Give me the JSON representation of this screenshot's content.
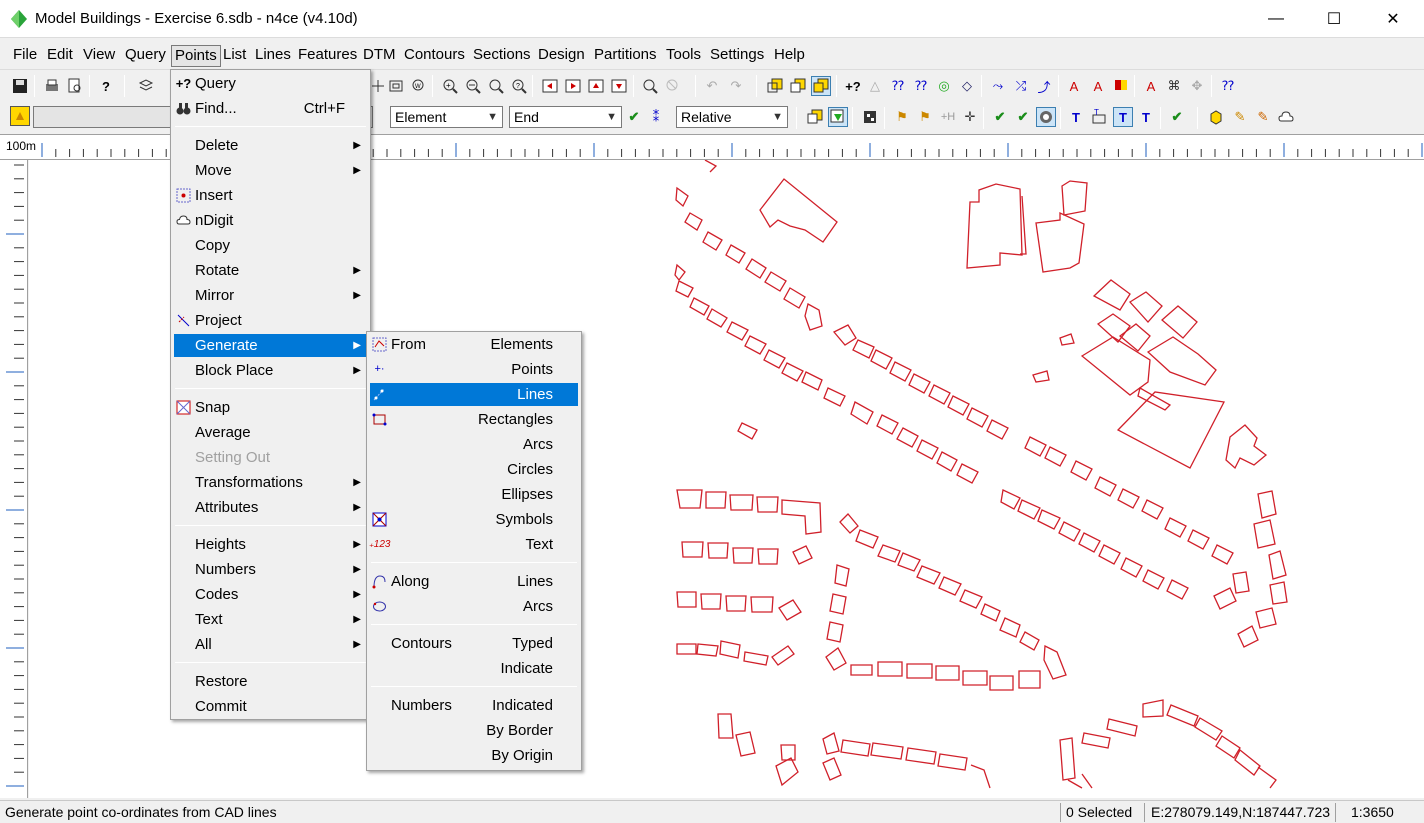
{
  "window": {
    "title": "Model Buildings - Exercise 6.sdb - n4ce (v4.10d)",
    "minimize": "—",
    "maximize": "☐",
    "close": "✕"
  },
  "menubar": [
    "File",
    "Edit",
    "View",
    "Query",
    "Points",
    "List",
    "Lines",
    "Features",
    "DTM",
    "Contours",
    "Sections",
    "Design",
    "Partitions",
    "Tools",
    "Settings",
    "Help"
  ],
  "toolbar2": {
    "combo_element": "Element",
    "combo_end": "End",
    "combo_relative": "Relative"
  },
  "ruler": {
    "label": "100m"
  },
  "points_menu": {
    "query": "Query",
    "find": "Find...",
    "find_shortcut": "Ctrl+F",
    "delete": "Delete",
    "move": "Move",
    "insert": "Insert",
    "ndigit": "nDigit",
    "copy": "Copy",
    "rotate": "Rotate",
    "mirror": "Mirror",
    "project": "Project",
    "generate": "Generate",
    "block_place": "Block Place",
    "snap": "Snap",
    "average": "Average",
    "setting_out": "Setting Out",
    "transformations": "Transformations",
    "attributes": "Attributes",
    "heights": "Heights",
    "numbers": "Numbers",
    "codes": "Codes",
    "text": "Text",
    "all": "All",
    "restore": "Restore",
    "commit": "Commit"
  },
  "generate_menu": {
    "from": "From",
    "elements": "Elements",
    "points": "Points",
    "lines": "Lines",
    "rectangles": "Rectangles",
    "arcs": "Arcs",
    "circles": "Circles",
    "ellipses": "Ellipses",
    "symbols": "Symbols",
    "text": "Text",
    "along": "Along",
    "along_lines": "Lines",
    "along_arcs": "Arcs",
    "contours": "Contours",
    "typed": "Typed",
    "indicate": "Indicate",
    "numbers": "Numbers",
    "indicated": "Indicated",
    "by_border": "By Border",
    "by_origin": "By Origin"
  },
  "status": {
    "message": "Generate point co-ordinates from CAD lines",
    "selected": "0 Selected",
    "coords": "E:278079.149,N:187447.723",
    "scale": "1:3650"
  },
  "colors": {
    "accent": "#0078d7",
    "drawing": "#d0202a"
  }
}
